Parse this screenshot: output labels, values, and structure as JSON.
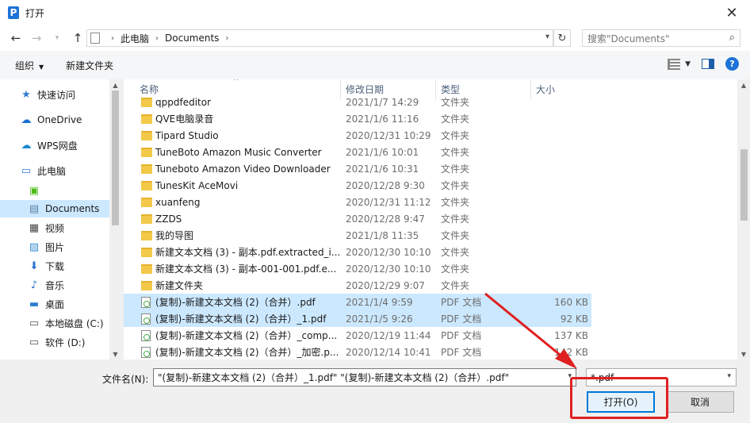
{
  "window": {
    "title": "打开",
    "app_icon": "P"
  },
  "nav": {
    "breadcrumb": [
      "此电脑",
      "Documents"
    ],
    "search_placeholder": "搜索\"Documents\""
  },
  "toolbar": {
    "organize": "组织",
    "new_folder": "新建文件夹",
    "help": "?"
  },
  "sidebar": {
    "items": [
      {
        "label": "快速访问",
        "icon": "star-icon",
        "glyph": "★",
        "color": "#2e7bd1"
      },
      {
        "label": "OneDrive",
        "icon": "cloud-icon",
        "glyph": "☁",
        "color": "#1a6ed1"
      },
      {
        "label": "WPS网盘",
        "icon": "wps-cloud-icon",
        "glyph": "☁",
        "color": "#1a8ad1"
      },
      {
        "label": "此电脑",
        "icon": "computer-icon",
        "glyph": "▭",
        "color": "#3a7bd5"
      },
      {
        "label": "",
        "icon": "green-app-icon",
        "glyph": "▣",
        "color": "#4cbb17"
      },
      {
        "label": "Documents",
        "icon": "documents-icon",
        "glyph": "▤",
        "color": "#5a7fa8",
        "selected": true
      },
      {
        "label": "视频",
        "icon": "video-icon",
        "glyph": "▦",
        "color": "#444"
      },
      {
        "label": "图片",
        "icon": "picture-icon",
        "glyph": "▨",
        "color": "#3a8fd0"
      },
      {
        "label": "下载",
        "icon": "download-icon",
        "glyph": "⬇",
        "color": "#2d6fd0"
      },
      {
        "label": "音乐",
        "icon": "music-icon",
        "glyph": "♪",
        "color": "#2d6fd0"
      },
      {
        "label": "桌面",
        "icon": "desktop-icon",
        "glyph": "▬",
        "color": "#2d7fd0"
      },
      {
        "label": "本地磁盘 (C:)",
        "icon": "drive-c-icon",
        "glyph": "▭",
        "color": "#555"
      },
      {
        "label": "软件 (D:)",
        "icon": "drive-d-icon",
        "glyph": "▭",
        "color": "#555"
      }
    ]
  },
  "columns": {
    "name": "名称",
    "date": "修改日期",
    "type": "类型",
    "size": "大小"
  },
  "files": [
    {
      "name": "qppdfeditor",
      "date": "2021/1/7 14:29",
      "type": "文件夹",
      "size": "",
      "kind": "folder",
      "selected": false
    },
    {
      "name": "QVE电脑录音",
      "date": "2021/1/6 11:16",
      "type": "文件夹",
      "size": "",
      "kind": "folder",
      "selected": false
    },
    {
      "name": "Tipard Studio",
      "date": "2020/12/31 10:29",
      "type": "文件夹",
      "size": "",
      "kind": "folder",
      "selected": false
    },
    {
      "name": "TuneBoto Amazon Music Converter",
      "date": "2021/1/6 10:01",
      "type": "文件夹",
      "size": "",
      "kind": "folder",
      "selected": false
    },
    {
      "name": "Tuneboto Amazon Video Downloader",
      "date": "2021/1/6 10:31",
      "type": "文件夹",
      "size": "",
      "kind": "folder",
      "selected": false
    },
    {
      "name": "TunesKit AceMovi",
      "date": "2020/12/28 9:30",
      "type": "文件夹",
      "size": "",
      "kind": "folder",
      "selected": false
    },
    {
      "name": "xuanfeng",
      "date": "2020/12/31 11:12",
      "type": "文件夹",
      "size": "",
      "kind": "folder",
      "selected": false
    },
    {
      "name": "ZZDS",
      "date": "2020/12/28 9:47",
      "type": "文件夹",
      "size": "",
      "kind": "folder",
      "selected": false
    },
    {
      "name": "我的导图",
      "date": "2021/1/8 11:35",
      "type": "文件夹",
      "size": "",
      "kind": "folder",
      "selected": false
    },
    {
      "name": "新建文本文档 (3) - 副本.pdf.extracted_i...",
      "date": "2020/12/30 10:10",
      "type": "文件夹",
      "size": "",
      "kind": "folder",
      "selected": false
    },
    {
      "name": "新建文本文档 (3) - 副本-001-001.pdf.e...",
      "date": "2020/12/30 10:10",
      "type": "文件夹",
      "size": "",
      "kind": "folder",
      "selected": false
    },
    {
      "name": "新建文件夹",
      "date": "2020/12/29 9:07",
      "type": "文件夹",
      "size": "",
      "kind": "folder",
      "selected": false
    },
    {
      "name": "(复制)-新建文本文档 (2)（合并）.pdf",
      "date": "2021/1/4 9:59",
      "type": "PDF 文档",
      "size": "160 KB",
      "kind": "pdf",
      "selected": true
    },
    {
      "name": "(复制)-新建文本文档 (2)（合并）_1.pdf",
      "date": "2021/1/5 9:26",
      "type": "PDF 文档",
      "size": "92 KB",
      "kind": "pdf",
      "selected": true
    },
    {
      "name": "(复制)-新建文本文档 (2)（合并）_comp...",
      "date": "2020/12/19 11:44",
      "type": "PDF 文档",
      "size": "137 KB",
      "kind": "pdf",
      "selected": false
    },
    {
      "name": "(复制)-新建文本文档 (2)（合并）_加密.p...",
      "date": "2020/12/14 10:41",
      "type": "PDF 文档",
      "size": "142 KB",
      "kind": "pdf",
      "selected": false
    }
  ],
  "bottom": {
    "filename_label": "文件名(N):",
    "filename_value": "\"(复制)-新建文本文档 (2)（合并）_1.pdf\" \"(复制)-新建文本文档 (2)（合并）.pdf\"",
    "filter": "*.pdf",
    "open": "打开(O)",
    "cancel": "取消"
  },
  "annotation": {
    "color": "#e02020"
  }
}
